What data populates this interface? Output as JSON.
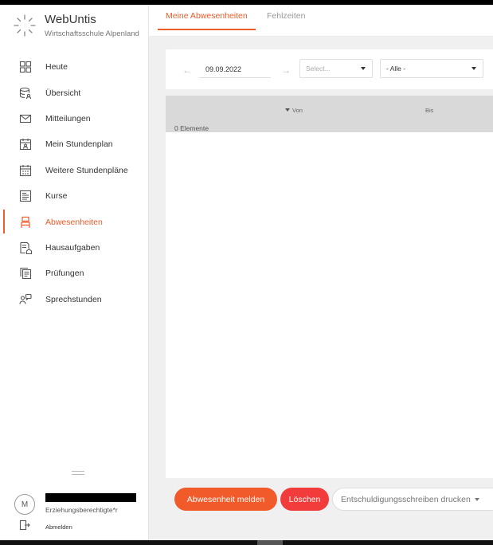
{
  "brand": {
    "title": "WebUntis",
    "subtitle": "Wirtschaftsschule Alpenland"
  },
  "sidebar": {
    "items": [
      {
        "label": "Heute",
        "icon": "dashboard-icon",
        "active": false
      },
      {
        "label": "Übersicht",
        "icon": "database-user-icon",
        "active": false
      },
      {
        "label": "Mitteilungen",
        "icon": "envelope-icon",
        "active": false
      },
      {
        "label": "Mein Stundenplan",
        "icon": "calendar-user-icon",
        "active": false
      },
      {
        "label": "Weitere Stundenpläne",
        "icon": "calendar-grid-icon",
        "active": false
      },
      {
        "label": "Kurse",
        "icon": "course-book-icon",
        "active": false
      },
      {
        "label": "Abwesenheiten",
        "icon": "chair-icon",
        "active": true
      },
      {
        "label": "Hausaufgaben",
        "icon": "homework-icon",
        "active": false
      },
      {
        "label": "Prüfungen",
        "icon": "exams-icon",
        "active": false
      },
      {
        "label": "Sprechstunden",
        "icon": "consultation-icon",
        "active": false
      }
    ]
  },
  "user": {
    "initial": "M",
    "role": "Erziehungsberechtigte*r",
    "logout_label": "Abmelden"
  },
  "tabs": {
    "active_label": "Meine Abwesenheiten",
    "inactive_label": "Fehlzeiten"
  },
  "filters": {
    "date_value": "09.09.2022",
    "select_placeholder": "Select...",
    "filter_value": "- Alle -"
  },
  "table": {
    "col_from": "Von",
    "col_to": "Bis",
    "count_text": "0 Elemente"
  },
  "actions": {
    "report_label": "Abwesenheit melden",
    "delete_label": "Löschen",
    "print_label": "Entschuldigungsschreiben drucken"
  },
  "colors": {
    "accent": "#f15a29",
    "danger": "#f23c3c"
  }
}
